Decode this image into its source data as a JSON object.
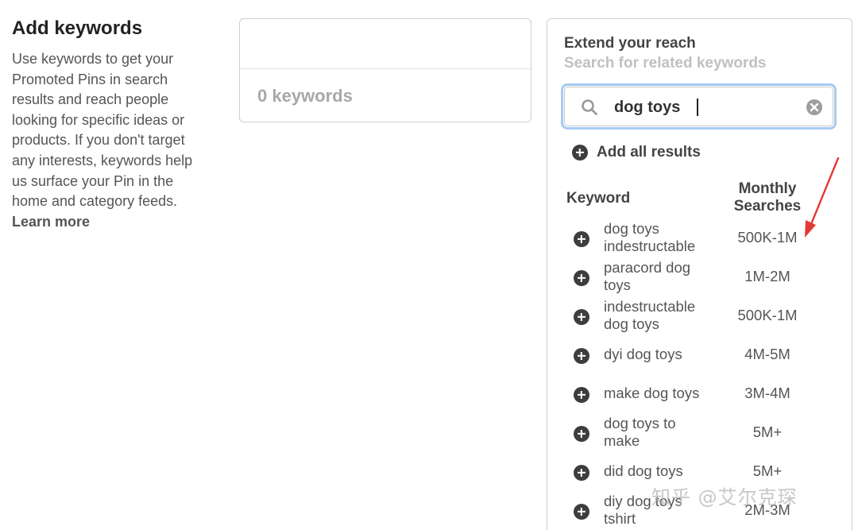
{
  "left": {
    "title": "Add keywords",
    "description": "Use keywords to get your Promoted Pins in search results and reach people looking for specific ideas or products. If you don't target any interests, keywords help us surface your Pin in the home and category feeds.",
    "learn_more": "Learn more"
  },
  "keywords_box": {
    "count_label": "0 keywords"
  },
  "panel": {
    "title": "Extend your reach",
    "subtitle": "Search for related keywords",
    "search": {
      "value": "dog toys",
      "icon": "search-icon",
      "clear_icon": "clear-icon"
    },
    "add_all_label": "Add all results",
    "columns": {
      "keyword": "Keyword",
      "monthly_line1": "Monthly",
      "monthly_line2": "Searches"
    },
    "results": [
      {
        "line1": "dog toys",
        "line2": "indestructable",
        "searches": "500K-1M"
      },
      {
        "line1": "paracord dog",
        "line2": "toys",
        "searches": "1M-2M"
      },
      {
        "line1": "indestructable",
        "line2": "dog toys",
        "searches": "500K-1M"
      },
      {
        "line1": "dyi dog toys",
        "line2": "",
        "searches": "4M-5M"
      },
      {
        "line1": "make dog toys",
        "line2": "",
        "searches": "3M-4M"
      },
      {
        "line1": "dog toys to",
        "line2": "make",
        "searches": "5M+"
      },
      {
        "line1": "did dog toys",
        "line2": "",
        "searches": "5M+"
      },
      {
        "line1": "diy dog toys",
        "line2": "tshirt",
        "searches": "2M-3M"
      }
    ]
  },
  "annotation": {
    "arrow_color": "#e53935"
  },
  "watermark": "知乎 @艾尔克琛"
}
